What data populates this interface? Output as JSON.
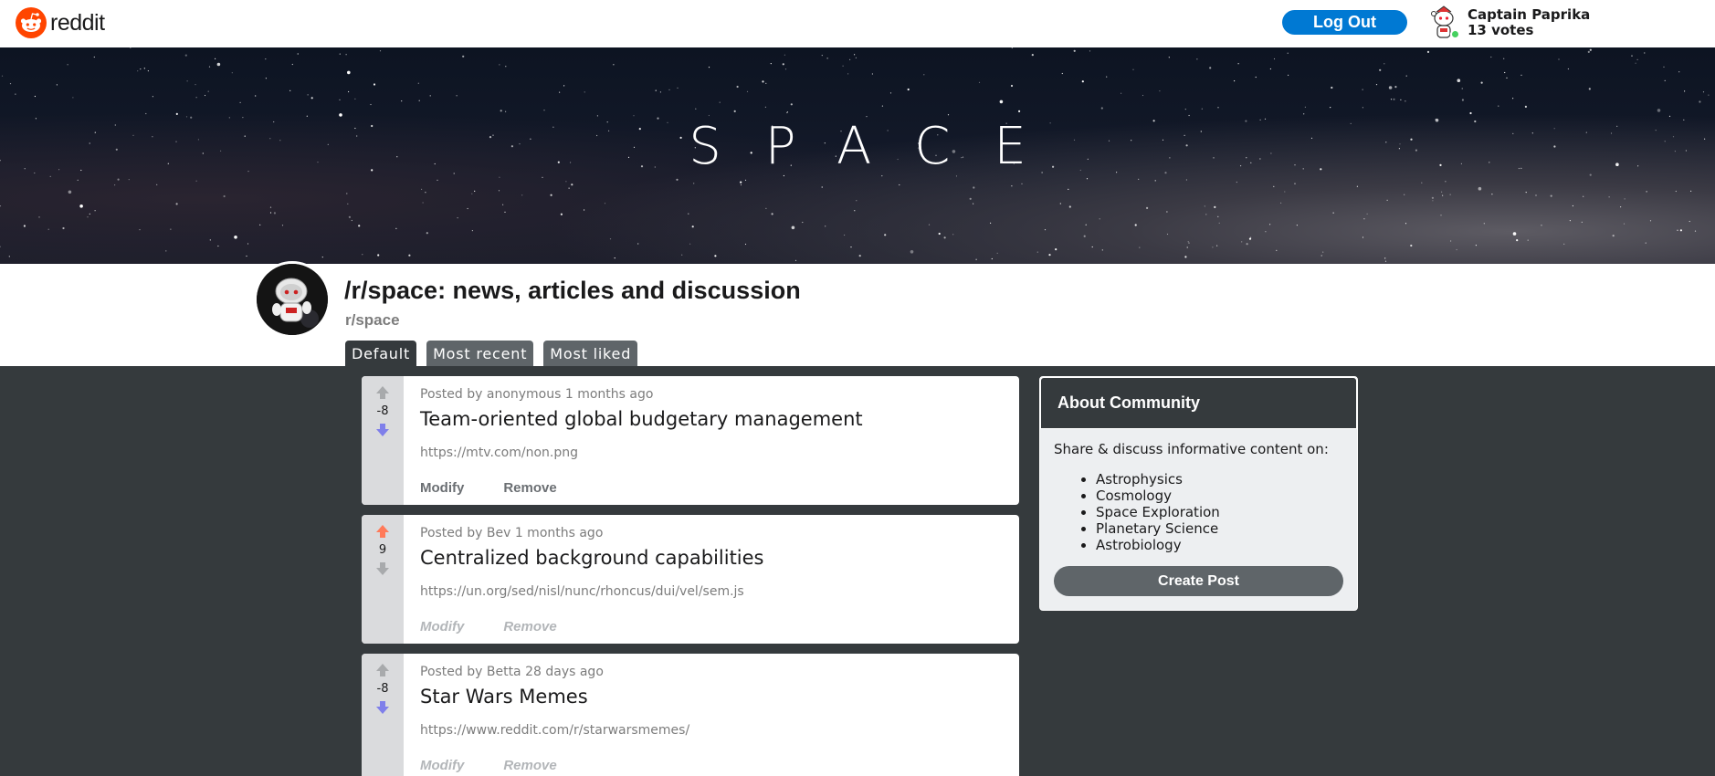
{
  "header": {
    "logo_text": "reddit",
    "logout_label": "Log Out",
    "user_name": "Captain Paprika",
    "user_votes": "13 votes"
  },
  "banner": {
    "title": "SPACE"
  },
  "subreddit": {
    "title": "/r/space: news, articles and discussion",
    "name": "r/space",
    "tabs": [
      {
        "label": "Default",
        "active": true
      },
      {
        "label": "Most recent",
        "active": false
      },
      {
        "label": "Most liked",
        "active": false
      }
    ]
  },
  "posts": [
    {
      "meta": "Posted by anonymous 1 months ago",
      "title": "Team-oriented global budgetary management",
      "link": "https://mtv.com/non.png",
      "score": "-8",
      "vote": "down",
      "modify": "Modify",
      "remove": "Remove"
    },
    {
      "meta": "Posted by Bev 1 months ago",
      "title": "Centralized background capabilities",
      "link": "https://un.org/sed/nisl/nunc/rhoncus/dui/vel/sem.js",
      "score": "9",
      "vote": "up",
      "modify": "Modify",
      "remove": "Remove"
    },
    {
      "meta": "Posted by Betta 28 days ago",
      "title": "Star Wars Memes",
      "link": "https://www.reddit.com/r/starwarsmemes/",
      "score": "-8",
      "vote": "down",
      "modify": "Modify",
      "remove": "Remove"
    }
  ],
  "about": {
    "heading": "About Community",
    "description": "Share & discuss informative content on:",
    "topics": [
      "Astrophysics",
      "Cosmology",
      "Space Exploration",
      "Planetary Science",
      "Astrobiology"
    ],
    "create_label": "Create Post"
  },
  "colors": {
    "brand": "#ff4500",
    "primary_button": "#0079d3",
    "upvote": "#ff7a59",
    "downvote": "#7f7fea",
    "neutral_arrow": "#a8aaac",
    "page_background": "#353a3d"
  }
}
